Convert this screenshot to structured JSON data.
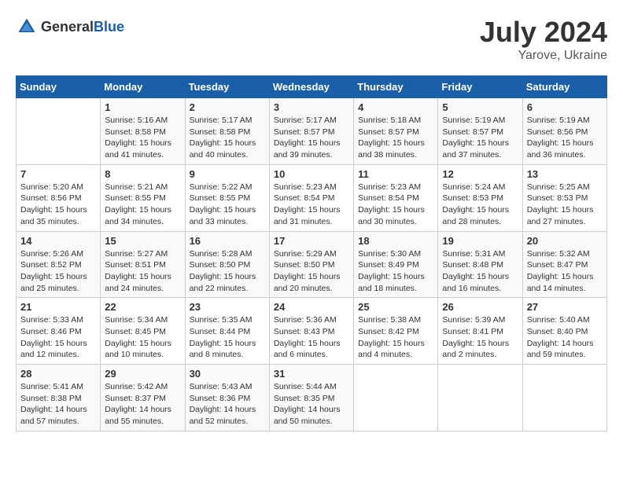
{
  "header": {
    "logo_general": "General",
    "logo_blue": "Blue",
    "month_year": "July 2024",
    "location": "Yarove, Ukraine"
  },
  "days_of_week": [
    "Sunday",
    "Monday",
    "Tuesday",
    "Wednesday",
    "Thursday",
    "Friday",
    "Saturday"
  ],
  "weeks": [
    [
      {
        "day": "",
        "info": ""
      },
      {
        "day": "1",
        "info": "Sunrise: 5:16 AM\nSunset: 8:58 PM\nDaylight: 15 hours\nand 41 minutes."
      },
      {
        "day": "2",
        "info": "Sunrise: 5:17 AM\nSunset: 8:58 PM\nDaylight: 15 hours\nand 40 minutes."
      },
      {
        "day": "3",
        "info": "Sunrise: 5:17 AM\nSunset: 8:57 PM\nDaylight: 15 hours\nand 39 minutes."
      },
      {
        "day": "4",
        "info": "Sunrise: 5:18 AM\nSunset: 8:57 PM\nDaylight: 15 hours\nand 38 minutes."
      },
      {
        "day": "5",
        "info": "Sunrise: 5:19 AM\nSunset: 8:57 PM\nDaylight: 15 hours\nand 37 minutes."
      },
      {
        "day": "6",
        "info": "Sunrise: 5:19 AM\nSunset: 8:56 PM\nDaylight: 15 hours\nand 36 minutes."
      }
    ],
    [
      {
        "day": "7",
        "info": "Sunrise: 5:20 AM\nSunset: 8:56 PM\nDaylight: 15 hours\nand 35 minutes."
      },
      {
        "day": "8",
        "info": "Sunrise: 5:21 AM\nSunset: 8:55 PM\nDaylight: 15 hours\nand 34 minutes."
      },
      {
        "day": "9",
        "info": "Sunrise: 5:22 AM\nSunset: 8:55 PM\nDaylight: 15 hours\nand 33 minutes."
      },
      {
        "day": "10",
        "info": "Sunrise: 5:23 AM\nSunset: 8:54 PM\nDaylight: 15 hours\nand 31 minutes."
      },
      {
        "day": "11",
        "info": "Sunrise: 5:23 AM\nSunset: 8:54 PM\nDaylight: 15 hours\nand 30 minutes."
      },
      {
        "day": "12",
        "info": "Sunrise: 5:24 AM\nSunset: 8:53 PM\nDaylight: 15 hours\nand 28 minutes."
      },
      {
        "day": "13",
        "info": "Sunrise: 5:25 AM\nSunset: 8:53 PM\nDaylight: 15 hours\nand 27 minutes."
      }
    ],
    [
      {
        "day": "14",
        "info": "Sunrise: 5:26 AM\nSunset: 8:52 PM\nDaylight: 15 hours\nand 25 minutes."
      },
      {
        "day": "15",
        "info": "Sunrise: 5:27 AM\nSunset: 8:51 PM\nDaylight: 15 hours\nand 24 minutes."
      },
      {
        "day": "16",
        "info": "Sunrise: 5:28 AM\nSunset: 8:50 PM\nDaylight: 15 hours\nand 22 minutes."
      },
      {
        "day": "17",
        "info": "Sunrise: 5:29 AM\nSunset: 8:50 PM\nDaylight: 15 hours\nand 20 minutes."
      },
      {
        "day": "18",
        "info": "Sunrise: 5:30 AM\nSunset: 8:49 PM\nDaylight: 15 hours\nand 18 minutes."
      },
      {
        "day": "19",
        "info": "Sunrise: 5:31 AM\nSunset: 8:48 PM\nDaylight: 15 hours\nand 16 minutes."
      },
      {
        "day": "20",
        "info": "Sunrise: 5:32 AM\nSunset: 8:47 PM\nDaylight: 15 hours\nand 14 minutes."
      }
    ],
    [
      {
        "day": "21",
        "info": "Sunrise: 5:33 AM\nSunset: 8:46 PM\nDaylight: 15 hours\nand 12 minutes."
      },
      {
        "day": "22",
        "info": "Sunrise: 5:34 AM\nSunset: 8:45 PM\nDaylight: 15 hours\nand 10 minutes."
      },
      {
        "day": "23",
        "info": "Sunrise: 5:35 AM\nSunset: 8:44 PM\nDaylight: 15 hours\nand 8 minutes."
      },
      {
        "day": "24",
        "info": "Sunrise: 5:36 AM\nSunset: 8:43 PM\nDaylight: 15 hours\nand 6 minutes."
      },
      {
        "day": "25",
        "info": "Sunrise: 5:38 AM\nSunset: 8:42 PM\nDaylight: 15 hours\nand 4 minutes."
      },
      {
        "day": "26",
        "info": "Sunrise: 5:39 AM\nSunset: 8:41 PM\nDaylight: 15 hours\nand 2 minutes."
      },
      {
        "day": "27",
        "info": "Sunrise: 5:40 AM\nSunset: 8:40 PM\nDaylight: 14 hours\nand 59 minutes."
      }
    ],
    [
      {
        "day": "28",
        "info": "Sunrise: 5:41 AM\nSunset: 8:38 PM\nDaylight: 14 hours\nand 57 minutes."
      },
      {
        "day": "29",
        "info": "Sunrise: 5:42 AM\nSunset: 8:37 PM\nDaylight: 14 hours\nand 55 minutes."
      },
      {
        "day": "30",
        "info": "Sunrise: 5:43 AM\nSunset: 8:36 PM\nDaylight: 14 hours\nand 52 minutes."
      },
      {
        "day": "31",
        "info": "Sunrise: 5:44 AM\nSunset: 8:35 PM\nDaylight: 14 hours\nand 50 minutes."
      },
      {
        "day": "",
        "info": ""
      },
      {
        "day": "",
        "info": ""
      },
      {
        "day": "",
        "info": ""
      }
    ]
  ]
}
